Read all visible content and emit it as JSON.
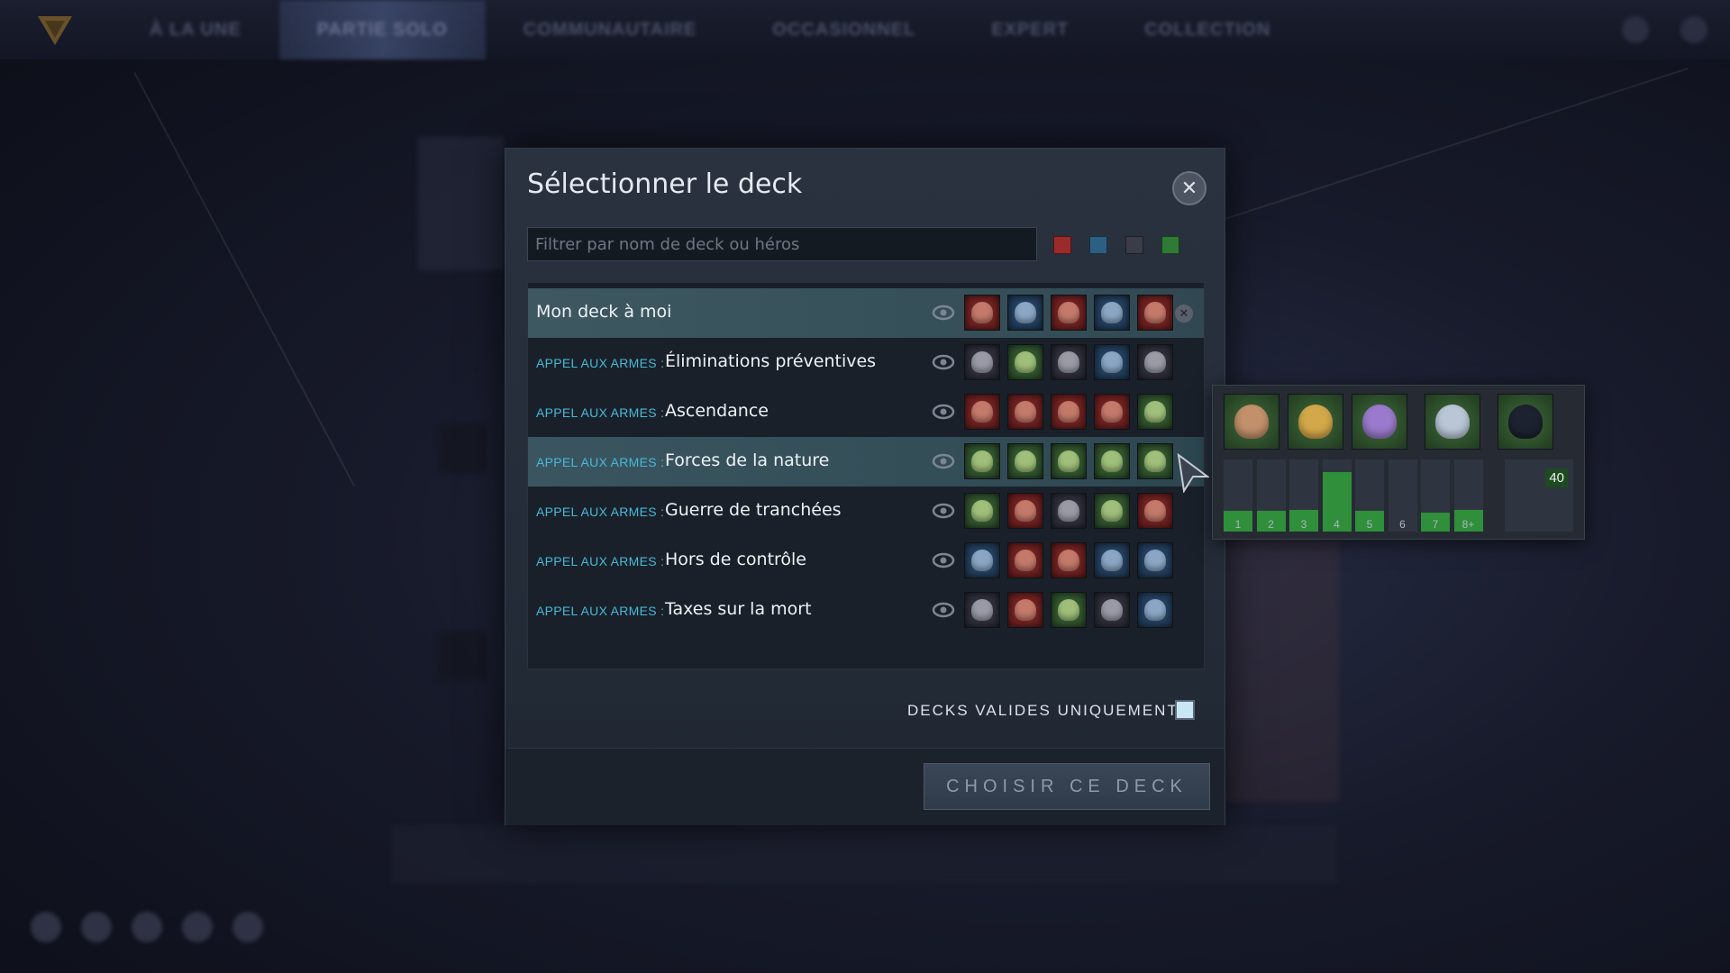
{
  "nav": {
    "items": [
      "À LA UNE",
      "PARTIE SOLO",
      "COMMUNAUTAIRE",
      "OCCASIONNEL",
      "EXPERT",
      "COLLECTION"
    ],
    "active_index": 1
  },
  "modal": {
    "title": "Sélectionner le deck",
    "close_icon": "close-icon",
    "search_placeholder": "Filtrer par nom de deck ou héros",
    "search_value": "",
    "color_filters": [
      {
        "name": "red",
        "color": "#9b2b2b"
      },
      {
        "name": "blue",
        "color": "#2c5f82"
      },
      {
        "name": "black",
        "color": "#3b3c48"
      },
      {
        "name": "green",
        "color": "#2f7a34"
      }
    ],
    "decks": [
      {
        "prefix": "",
        "name": "Mon deck à moi",
        "heroes": [
          "red",
          "blue",
          "red",
          "blue",
          "red"
        ],
        "state": "selected",
        "removable": true
      },
      {
        "prefix": "APPEL AUX ARMES :",
        "name": "Éliminations préventives",
        "heroes": [
          "black",
          "green",
          "black",
          "blue",
          "black"
        ],
        "state": "",
        "removable": false
      },
      {
        "prefix": "APPEL AUX ARMES :",
        "name": "Ascendance",
        "heroes": [
          "red",
          "red",
          "red",
          "red",
          "green"
        ],
        "state": "",
        "removable": false
      },
      {
        "prefix": "APPEL AUX ARMES :",
        "name": "Forces de la nature",
        "heroes": [
          "green",
          "green",
          "green",
          "green",
          "green"
        ],
        "state": "hovered",
        "removable": false
      },
      {
        "prefix": "APPEL AUX ARMES :",
        "name": "Guerre de tranchées",
        "heroes": [
          "green",
          "red",
          "black",
          "green",
          "red"
        ],
        "state": "",
        "removable": false
      },
      {
        "prefix": "APPEL AUX ARMES :",
        "name": "Hors de contrôle",
        "heroes": [
          "blue",
          "red",
          "red",
          "blue",
          "blue"
        ],
        "state": "",
        "removable": false
      },
      {
        "prefix": "APPEL AUX ARMES :",
        "name": "Taxes sur la mort",
        "heroes": [
          "black",
          "red",
          "green",
          "black",
          "blue"
        ],
        "state": "",
        "removable": false
      }
    ],
    "valid_only_label": "DECKS VALIDES UNIQUEMENT :",
    "valid_only_checked": false,
    "choose_button": "CHOISIR CE DECK"
  },
  "preview": {
    "deck": "Forces de la nature",
    "hero_color": "green",
    "heroes_count": 5,
    "mana_curve": [
      {
        "label": "1",
        "level": 0.06
      },
      {
        "label": "2",
        "level": 0.06
      },
      {
        "label": "3",
        "level": 0.08
      },
      {
        "label": "4",
        "level": 0.6
      },
      {
        "label": "5",
        "level": 0.06
      },
      {
        "label": "6",
        "level": 0.0
      },
      {
        "label": "7",
        "level": 0.04
      },
      {
        "label": "8+",
        "level": 0.08
      }
    ],
    "card_count": "40"
  }
}
